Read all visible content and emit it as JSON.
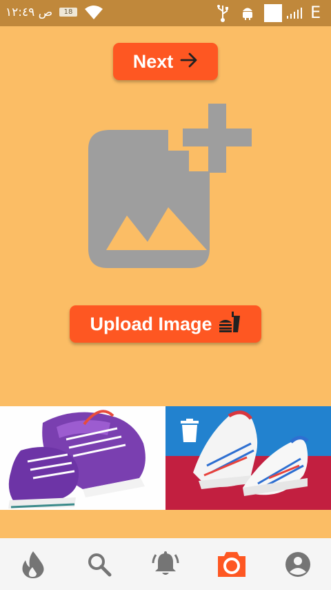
{
  "status_bar": {
    "time": "ص ١٢:٤٩",
    "battery_level": "18",
    "network_type": "E"
  },
  "actions": {
    "next_label": "Next",
    "upload_label": "Upload Image"
  },
  "gallery": {
    "images": [
      {
        "subject": "purple-sneakers"
      },
      {
        "subject": "white-red-blue-sneakers"
      }
    ]
  },
  "nav": {
    "items": [
      "fire-icon",
      "search-icon",
      "bell-icon",
      "camera-icon",
      "account-icon"
    ],
    "selected": 3
  },
  "colors": {
    "accent": "#fe5722",
    "background": "#fbbd65",
    "status_bar": "#c0883b",
    "icon_gray": "#9e9e9e"
  }
}
